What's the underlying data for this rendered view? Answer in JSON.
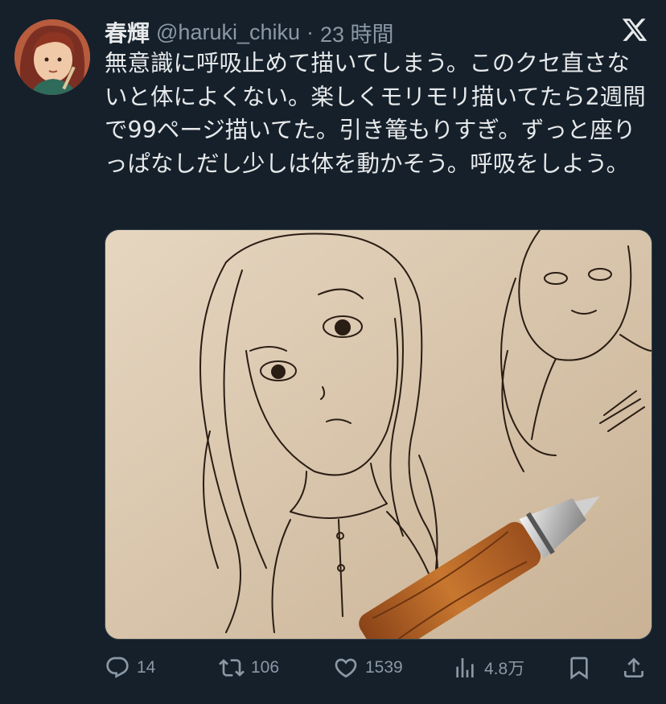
{
  "tweet": {
    "display_name": "春輝",
    "handle": "@haruki_chiku",
    "separator": "·",
    "time": "23 時間",
    "text": "無意識に呼吸止めて描いてしまう。このクセ直さないと体によくない。楽しくモリモリ描いてたら2週間で99ページ描いてた。引き篭もりすぎ。ずっと座りっぱなしだし少しは体を動かそう。呼吸をしよう。"
  },
  "icons": {
    "brand": "x-logo-icon",
    "reply": "reply-icon",
    "retweet": "retweet-icon",
    "like": "heart-icon",
    "views": "views-icon",
    "bookmark": "bookmark-icon",
    "share": "share-icon"
  },
  "actions": {
    "replies": "14",
    "retweets": "106",
    "likes": "1539",
    "views": "4.8万"
  },
  "colors": {
    "background": "#15202b",
    "text": "#e7e9ea",
    "muted": "#8b98a5"
  }
}
